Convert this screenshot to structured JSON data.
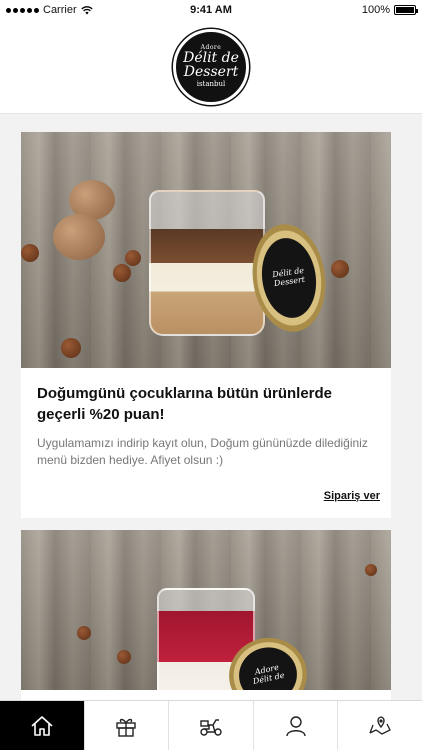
{
  "status_bar": {
    "carrier": "Carrier",
    "time": "9:41 AM",
    "battery": "100%",
    "battery_level": 1.0
  },
  "header": {
    "logo_text_small": "Adore",
    "logo_text_main_1": "Délit de",
    "logo_text_main_2": "Dessert",
    "logo_text_sub": "istanbul"
  },
  "feed": {
    "cards": [
      {
        "title": "Doğumgünü çocuklarına bütün ürünlerde geçerli %20 puan!",
        "description": "Uygulamamızı indirip kayıt olun, Doğum gününüzde dilediğiniz menü bizden hediye. Afiyet olsun :)",
        "action_label": "Sipariş ver",
        "lid_text_1": "Délit de",
        "lid_text_2": "Dessert"
      },
      {
        "lid_text_1": "Adore",
        "lid_text_2": "Délit de"
      }
    ]
  },
  "tab_bar": {
    "tabs": [
      {
        "icon": "home-icon",
        "active": true
      },
      {
        "icon": "gift-icon",
        "active": false
      },
      {
        "icon": "scooter-icon",
        "active": false
      },
      {
        "icon": "user-icon",
        "active": false
      },
      {
        "icon": "location-icon",
        "active": false
      }
    ]
  },
  "colors": {
    "active_tab": "#000000",
    "background": "#f2f2f2",
    "text": "#111111",
    "muted_text": "#777777"
  }
}
